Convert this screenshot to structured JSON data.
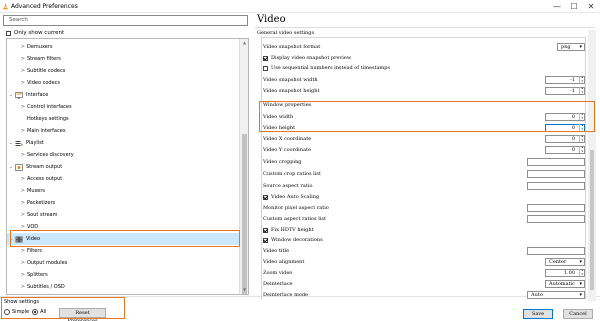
{
  "window": {
    "title": "Advanced Preferences",
    "minimize": "—",
    "maximize": "☐",
    "close": "✕"
  },
  "search": {
    "placeholder": "Search"
  },
  "filter": {
    "only_current_label": "Only show current",
    "checked": false
  },
  "tree": [
    {
      "label": "Demuxers",
      "level": 2,
      "icon": ""
    },
    {
      "label": "Stream filters",
      "level": 2,
      "icon": ""
    },
    {
      "label": "Subtitle codecs",
      "level": 2,
      "icon": ""
    },
    {
      "label": "Video codecs",
      "level": 2,
      "icon": ""
    },
    {
      "label": "Interface",
      "level": 1,
      "icon": "interface-icon"
    },
    {
      "label": "Control interfaces",
      "level": 2,
      "icon": ""
    },
    {
      "label": "Hotkeys settings",
      "level": 2,
      "icon": ""
    },
    {
      "label": "Main interfaces",
      "level": 2,
      "icon": ""
    },
    {
      "label": "Playlist",
      "level": 1,
      "icon": "playlist-icon"
    },
    {
      "label": "Services discovery",
      "level": 2,
      "icon": ""
    },
    {
      "label": "Stream output",
      "level": 1,
      "icon": "stream-output-icon"
    },
    {
      "label": "Access output",
      "level": 2,
      "icon": ""
    },
    {
      "label": "Muxers",
      "level": 2,
      "icon": ""
    },
    {
      "label": "Packetizers",
      "level": 2,
      "icon": ""
    },
    {
      "label": "Sout stream",
      "level": 2,
      "icon": ""
    },
    {
      "label": "VOD",
      "level": 2,
      "icon": ""
    },
    {
      "label": "Video",
      "level": 1,
      "icon": "video-icon",
      "selected": true
    },
    {
      "label": "Filters",
      "level": 2,
      "icon": ""
    },
    {
      "label": "Output modules",
      "level": 2,
      "icon": ""
    },
    {
      "label": "Splitters",
      "level": 2,
      "icon": ""
    },
    {
      "label": "Subtitles / OSD",
      "level": 2,
      "icon": ""
    }
  ],
  "show_settings": {
    "label": "Show settings",
    "simple": "Simple",
    "all": "All",
    "selected": "All",
    "reset": "Reset Preferences"
  },
  "section": {
    "title": "Video",
    "group": "General video settings"
  },
  "settings": {
    "snapshot_format": {
      "label": "Video snapshot format",
      "value": "png"
    },
    "display_snapshot_preview": {
      "label": "Display video snapshot preview",
      "checked": true
    },
    "sequential_numbers": {
      "label": "Use sequential numbers instead of timestamps",
      "checked": false
    },
    "snapshot_width": {
      "label": "Video snapshot width",
      "value": "-1"
    },
    "snapshot_height": {
      "label": "Video snapshot height",
      "value": "-1"
    },
    "window_properties": "Window properties",
    "video_width": {
      "label": "Video width",
      "value": "0"
    },
    "video_height": {
      "label": "Video height",
      "value": "0"
    },
    "video_x": {
      "label": "Video X coordinate",
      "value": "0"
    },
    "video_y": {
      "label": "Video Y coordinate",
      "value": "0"
    },
    "video_cropping": {
      "label": "Video cropping",
      "value": ""
    },
    "custom_crop_ratios": {
      "label": "Custom crop ratios list",
      "value": ""
    },
    "source_aspect_ratio": {
      "label": "Source aspect ratio",
      "value": ""
    },
    "video_auto_scaling": {
      "label": "Video Auto Scaling",
      "checked": true
    },
    "monitor_pixel_aspect": {
      "label": "Monitor pixel aspect ratio",
      "value": ""
    },
    "custom_aspect_ratios": {
      "label": "Custom aspect ratios list",
      "value": ""
    },
    "fix_hdtv_height": {
      "label": "Fix HDTV height",
      "checked": true
    },
    "window_decorations": {
      "label": "Window decorations",
      "checked": true
    },
    "video_title": {
      "label": "Video title",
      "value": ""
    },
    "video_alignment": {
      "label": "Video alignment",
      "value": "Center"
    },
    "zoom_video": {
      "label": "Zoom video",
      "value": "1.00"
    },
    "deinterlace": {
      "label": "Deinterlace",
      "value": "Automatic"
    },
    "deinterlace_mode": {
      "label": "Deinterlace mode",
      "value": "Auto"
    }
  },
  "buttons": {
    "save": "Save",
    "cancel": "Cancel"
  },
  "colors": {
    "highlight": "#e8761e"
  }
}
